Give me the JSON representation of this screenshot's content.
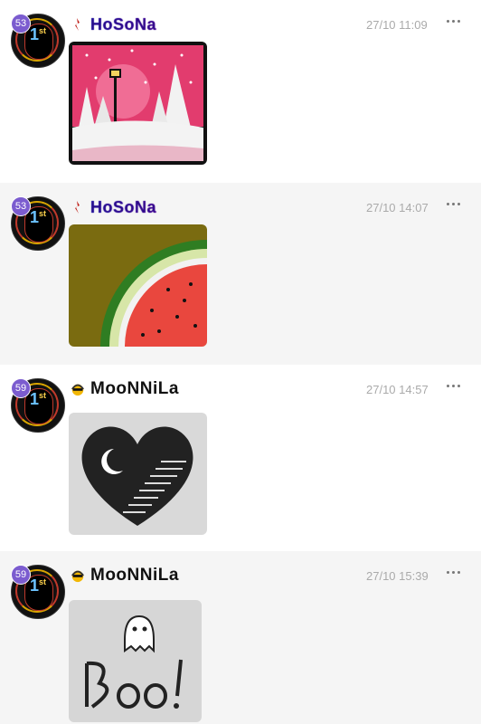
{
  "posts": [
    {
      "level": "53",
      "username": "HoSoNa",
      "time": "27/10 11:09"
    },
    {
      "level": "53",
      "username": "HoSoNa",
      "time": "27/10 14:07"
    },
    {
      "level": "59",
      "username": "MooNNiLa",
      "time": "27/10 14:57"
    },
    {
      "level": "59",
      "username": "MooNNiLa",
      "time": "27/10 15:39"
    }
  ],
  "badge": {
    "label": "1",
    "suffix": "st"
  },
  "colors": {
    "level_badge": "#7b5ccf",
    "time_text": "#aaaaaa",
    "alt_background": "#f5f5f5"
  },
  "icons": {
    "more": "more-dots-icon",
    "flag_hosona": "red-flag-icon",
    "flag_moonnila": "emoji-face-icon"
  }
}
